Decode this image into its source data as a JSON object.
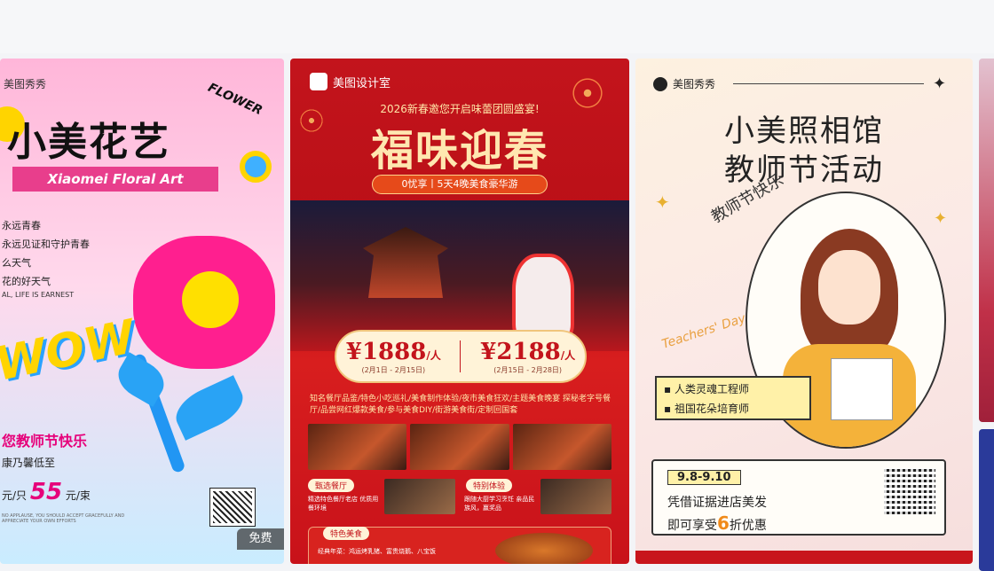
{
  "cards": [
    {
      "brand": "美图秀秀",
      "title": "小美花艺",
      "flower_word": "FLOWER",
      "en_title": "Xiaomei Floral Art",
      "lines": [
        "永远青春",
        "永远见证和守护青春",
        "么天气",
        "花的好天气"
      ],
      "small_en": "AL, LIFE IS EARNEST",
      "wow": "WOW",
      "greeting": "您教师节快乐",
      "sub": "康乃馨低至",
      "price_prefix": "元/只",
      "price_value": "55",
      "price_suffix": "元/束",
      "tiny_text": "NO APPLAUSE, YOU SHOULD ACCEPT GRACEFULLY AND APPRECIATE YOUR OWN EFFORTS",
      "free_badge": "免费"
    },
    {
      "brand": "美图设计室",
      "invite": "2026新春邀您开启味蕾团圆盛宴!",
      "title": "福味迎春",
      "tagline": "0忧享丨5天4晚美食豪华游",
      "prices": [
        {
          "value": "¥1888",
          "unit": "/人",
          "dates": "(2月1日 - 2月15日)"
        },
        {
          "value": "¥2188",
          "unit": "/人",
          "dates": "(2月15日 - 2月28日)"
        }
      ],
      "desc": "知名餐厅品鉴/特色小吃巡礼/美食制作体验/夜市美食狂欢/主题美食晚宴 探秘老字号餐厅/品尝网红爆款美食/参与美食DIY/街游美食街/定制回国套",
      "label_a": "甄选餐厅",
      "label_b": "特别体验",
      "label_c": "特色美食",
      "small_a": "精选特色餐厅老店 优质用餐环境",
      "small_b": "跟随大厨学习烹饪 亲品民族风，赢奖品",
      "small_c": "经典年菜：鸿运烤乳猪、富贵烧鹅、八宝饭"
    },
    {
      "brand": "美图秀秀",
      "title_line1": "小美照相馆",
      "title_line2": "教师节活动",
      "vertical": "教师节快乐",
      "script": "Teachers' Day",
      "tags": [
        "人类灵魂工程师",
        "祖国花朵培育师"
      ],
      "date": "9.8-9.10",
      "line1": "凭借证据进店美发",
      "line2_a": "即可享受",
      "line2_b": "6",
      "line2_c": "折优惠"
    }
  ]
}
